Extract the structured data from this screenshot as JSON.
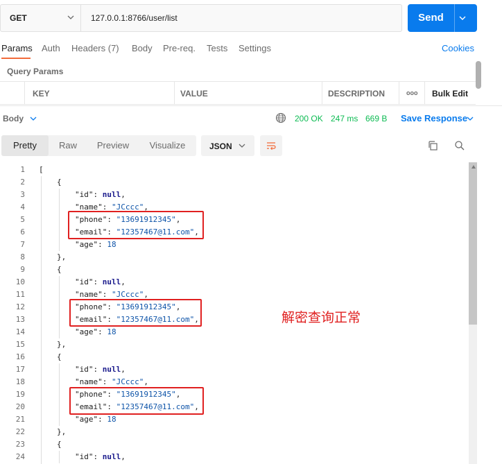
{
  "request": {
    "method": "GET",
    "url": "127.0.0.1:8766/user/list",
    "send_label": "Send"
  },
  "request_tabs": [
    {
      "label": "Params",
      "active": true
    },
    {
      "label": "Auth"
    },
    {
      "label": "Headers (7)"
    },
    {
      "label": "Body"
    },
    {
      "label": "Pre-req."
    },
    {
      "label": "Tests"
    },
    {
      "label": "Settings"
    }
  ],
  "cookies_label": "Cookies",
  "query_params_label": "Query Params",
  "params_table": {
    "columns": [
      "KEY",
      "VALUE",
      "DESCRIPTION"
    ],
    "more_label": "ooo",
    "bulk_edit_label": "Bulk Edit"
  },
  "response": {
    "body_label": "Body",
    "status": "200 OK",
    "time": "247 ms",
    "size": "669 B",
    "save_label": "Save Response"
  },
  "view_tabs": [
    {
      "label": "Pretty",
      "active": true
    },
    {
      "label": "Raw"
    },
    {
      "label": "Preview"
    },
    {
      "label": "Visualize"
    }
  ],
  "format": "JSON",
  "annotation_note": "解密查询正常",
  "icons": {
    "method_dropdown": "chevron-down-icon",
    "send_dropdown": "chevron-down-icon",
    "globe": "globe-icon",
    "wrap": "wrap-lines-icon",
    "copy": "copy-icon",
    "search": "search-icon"
  },
  "colors": {
    "send_button": "#097bed",
    "accent_tab": "#f26b3a",
    "status_ok": "#0cbb52",
    "link": "#097bed",
    "annotation": "#e02020"
  },
  "code_lines": [
    {
      "n": "1",
      "indent": 0,
      "parts": [
        [
          "p",
          "["
        ]
      ]
    },
    {
      "n": "2",
      "indent": 1,
      "parts": [
        [
          "p",
          "{"
        ]
      ]
    },
    {
      "n": "3",
      "indent": 2,
      "parts": [
        [
          "k",
          "\"id\""
        ],
        [
          "p",
          ": "
        ],
        [
          "nl",
          "null"
        ],
        [
          "p",
          ","
        ]
      ]
    },
    {
      "n": "4",
      "indent": 2,
      "parts": [
        [
          "k",
          "\"name\""
        ],
        [
          "p",
          ": "
        ],
        [
          "s",
          "\"JCccc\""
        ],
        [
          "p",
          ","
        ]
      ]
    },
    {
      "n": "5",
      "indent": 2,
      "parts": [
        [
          "k",
          "\"phone\""
        ],
        [
          "p",
          ": "
        ],
        [
          "s",
          "\"13691912345\""
        ],
        [
          "p",
          ","
        ]
      ]
    },
    {
      "n": "6",
      "indent": 2,
      "parts": [
        [
          "k",
          "\"email\""
        ],
        [
          "p",
          ": "
        ],
        [
          "s",
          "\"12357467@11.com\""
        ],
        [
          "p",
          ","
        ]
      ]
    },
    {
      "n": "7",
      "indent": 2,
      "parts": [
        [
          "k",
          "\"age\""
        ],
        [
          "p",
          ": "
        ],
        [
          "n",
          "18"
        ]
      ]
    },
    {
      "n": "8",
      "indent": 1,
      "parts": [
        [
          "p",
          "},"
        ]
      ]
    },
    {
      "n": "9",
      "indent": 1,
      "parts": [
        [
          "p",
          "{"
        ]
      ]
    },
    {
      "n": "10",
      "indent": 2,
      "parts": [
        [
          "k",
          "\"id\""
        ],
        [
          "p",
          ": "
        ],
        [
          "nl",
          "null"
        ],
        [
          "p",
          ","
        ]
      ]
    },
    {
      "n": "11",
      "indent": 2,
      "parts": [
        [
          "k",
          "\"name\""
        ],
        [
          "p",
          ": "
        ],
        [
          "s",
          "\"JCccc\""
        ],
        [
          "p",
          ","
        ]
      ]
    },
    {
      "n": "12",
      "indent": 2,
      "parts": [
        [
          "k",
          "\"phone\""
        ],
        [
          "p",
          ": "
        ],
        [
          "s",
          "\"13691912345\""
        ],
        [
          "p",
          ","
        ]
      ]
    },
    {
      "n": "13",
      "indent": 2,
      "parts": [
        [
          "k",
          "\"email\""
        ],
        [
          "p",
          ": "
        ],
        [
          "s",
          "\"12357467@11.com\""
        ],
        [
          "p",
          ","
        ]
      ]
    },
    {
      "n": "14",
      "indent": 2,
      "parts": [
        [
          "k",
          "\"age\""
        ],
        [
          "p",
          ": "
        ],
        [
          "n",
          "18"
        ]
      ]
    },
    {
      "n": "15",
      "indent": 1,
      "parts": [
        [
          "p",
          "},"
        ]
      ]
    },
    {
      "n": "16",
      "indent": 1,
      "parts": [
        [
          "p",
          "{"
        ]
      ]
    },
    {
      "n": "17",
      "indent": 2,
      "parts": [
        [
          "k",
          "\"id\""
        ],
        [
          "p",
          ": "
        ],
        [
          "nl",
          "null"
        ],
        [
          "p",
          ","
        ]
      ]
    },
    {
      "n": "18",
      "indent": 2,
      "parts": [
        [
          "k",
          "\"name\""
        ],
        [
          "p",
          ": "
        ],
        [
          "s",
          "\"JCccc\""
        ],
        [
          "p",
          ","
        ]
      ]
    },
    {
      "n": "19",
      "indent": 2,
      "parts": [
        [
          "k",
          "\"phone\""
        ],
        [
          "p",
          ": "
        ],
        [
          "s",
          "\"13691912345\""
        ],
        [
          "p",
          ","
        ]
      ]
    },
    {
      "n": "20",
      "indent": 2,
      "parts": [
        [
          "k",
          "\"email\""
        ],
        [
          "p",
          ": "
        ],
        [
          "s",
          "\"12357467@11.com\""
        ],
        [
          "p",
          ","
        ]
      ]
    },
    {
      "n": "21",
      "indent": 2,
      "parts": [
        [
          "k",
          "\"age\""
        ],
        [
          "p",
          ": "
        ],
        [
          "n",
          "18"
        ]
      ]
    },
    {
      "n": "22",
      "indent": 1,
      "parts": [
        [
          "p",
          "},"
        ]
      ]
    },
    {
      "n": "23",
      "indent": 1,
      "parts": [
        [
          "p",
          "{"
        ]
      ]
    },
    {
      "n": "24",
      "indent": 2,
      "parts": [
        [
          "k",
          "\"id\""
        ],
        [
          "p",
          ": "
        ],
        [
          "nl",
          "null"
        ],
        [
          "p",
          ","
        ]
      ]
    }
  ]
}
